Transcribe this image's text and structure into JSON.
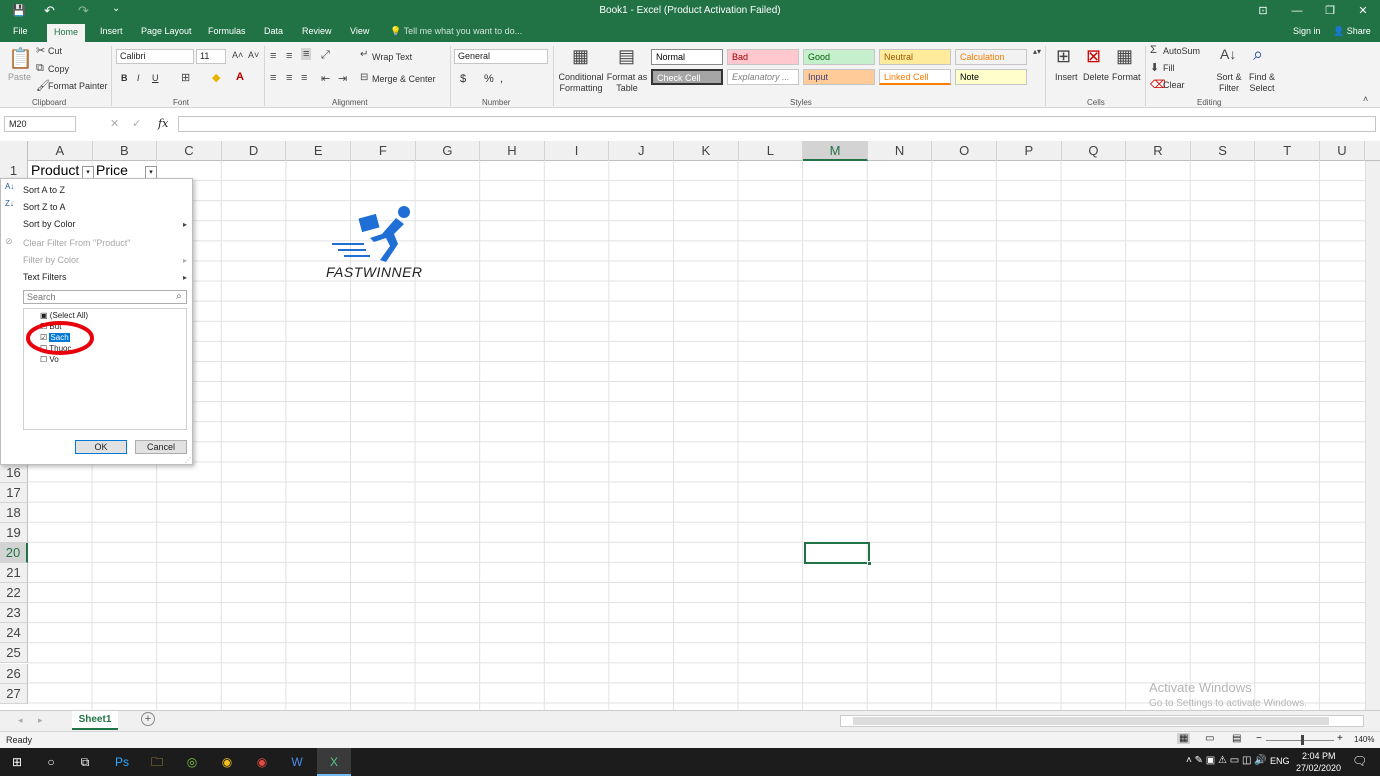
{
  "window": {
    "title": "Book1 - Excel (Product Activation Failed)",
    "qat_save": "💾",
    "undo": "↶",
    "redo": "↷",
    "more": "⌄",
    "min": "—",
    "restore": "❐",
    "close": "✕",
    "ribbon_opts": "⊡"
  },
  "tabs": [
    "File",
    "Home",
    "Insert",
    "Page Layout",
    "Formulas",
    "Data",
    "Review",
    "View"
  ],
  "tell_me": "Tell me what you want to do...",
  "account": {
    "signin": "Sign in",
    "share": "Share"
  },
  "ribbon": {
    "clipboard": {
      "paste": "Paste",
      "cut": "Cut",
      "copy": "Copy",
      "format_painter": "Format Painter",
      "label": "Clipboard"
    },
    "font": {
      "name": "Calibri",
      "size": "11",
      "label": "Font",
      "bold": "B",
      "italic": "I",
      "underline": "U"
    },
    "alignment": {
      "wrap": "Wrap Text",
      "merge": "Merge & Center",
      "label": "Alignment"
    },
    "number": {
      "format": "General",
      "currency": "$",
      "percent": "%",
      "comma": ",",
      "label": "Number"
    },
    "styles": {
      "cond": "Conditional Formatting",
      "fmt_table": "Format as Table",
      "label": "Styles",
      "boxes": [
        {
          "t": "Normal",
          "bg": "#ffffff",
          "c": "#000000"
        },
        {
          "t": "Bad",
          "bg": "#ffc7ce",
          "c": "#9c0006"
        },
        {
          "t": "Good",
          "bg": "#c6efce",
          "c": "#006100"
        },
        {
          "t": "Neutral",
          "bg": "#ffeb9c",
          "c": "#9c5700"
        },
        {
          "t": "Calculation",
          "bg": "#f2f2f2",
          "c": "#fa7d00"
        },
        {
          "t": "Check Cell",
          "bg": "#a5a5a5",
          "c": "#ffffff"
        },
        {
          "t": "Explanatory ...",
          "bg": "#ffffff",
          "c": "#7f7f7f"
        },
        {
          "t": "Input",
          "bg": "#ffcc99",
          "c": "#3f3f76"
        },
        {
          "t": "Linked Cell",
          "bg": "#ffffff",
          "c": "#fa7d00"
        },
        {
          "t": "Note",
          "bg": "#ffffcc",
          "c": "#000000"
        }
      ]
    },
    "cells": {
      "insert": "Insert",
      "delete": "Delete",
      "format": "Format",
      "label": "Cells"
    },
    "editing": {
      "autosum": "AutoSum",
      "fill": "Fill",
      "clear": "Clear",
      "sort": "Sort & Filter",
      "find": "Find & Select",
      "label": "Editing"
    }
  },
  "namebox": "M20",
  "fx": "fx",
  "columns": [
    "A",
    "B",
    "C",
    "D",
    "E",
    "F",
    "G",
    "H",
    "I",
    "J",
    "K",
    "L",
    "M",
    "N",
    "O",
    "P",
    "Q",
    "R",
    "S",
    "T",
    "U"
  ],
  "selected_col": "M",
  "rows_top": [
    "1"
  ],
  "rows_bottom": [
    "16",
    "17",
    "18",
    "19",
    "20",
    "21",
    "22",
    "23",
    "24",
    "25",
    "26",
    "27"
  ],
  "selected_row": "20",
  "cells": {
    "a1": "Product",
    "b1": "Price"
  },
  "logo_text": "FASTWINNER",
  "filter_menu": {
    "sort_az": "Sort A to Z",
    "sort_za": "Sort Z to A",
    "sort_color": "Sort by Color",
    "clear_filter": "Clear Filter From \"Product\"",
    "filter_color": "Filter by Color",
    "text_filters": "Text Filters",
    "search_placeholder": "Search",
    "items": [
      {
        "label": "(Select All)",
        "checked": "partial"
      },
      {
        "label": "But",
        "checked": false
      },
      {
        "label": "Sach",
        "checked": true
      },
      {
        "label": "Thuoc",
        "checked": false
      },
      {
        "label": "Vo",
        "checked": false
      }
    ],
    "ok": "OK",
    "cancel": "Cancel"
  },
  "sheet": {
    "tab": "Sheet1",
    "add": "+"
  },
  "activate": {
    "title": "Activate Windows",
    "sub": "Go to Settings to activate Windows."
  },
  "status": {
    "ready": "Ready",
    "zoom": "140%"
  },
  "taskbar": {
    "lang": "ENG",
    "time": "2:04 PM",
    "date": "27/02/2020"
  },
  "colors": {
    "excel_green": "#217346",
    "annotation_red": "#e8000b",
    "selection_blue": "#0078d7"
  }
}
